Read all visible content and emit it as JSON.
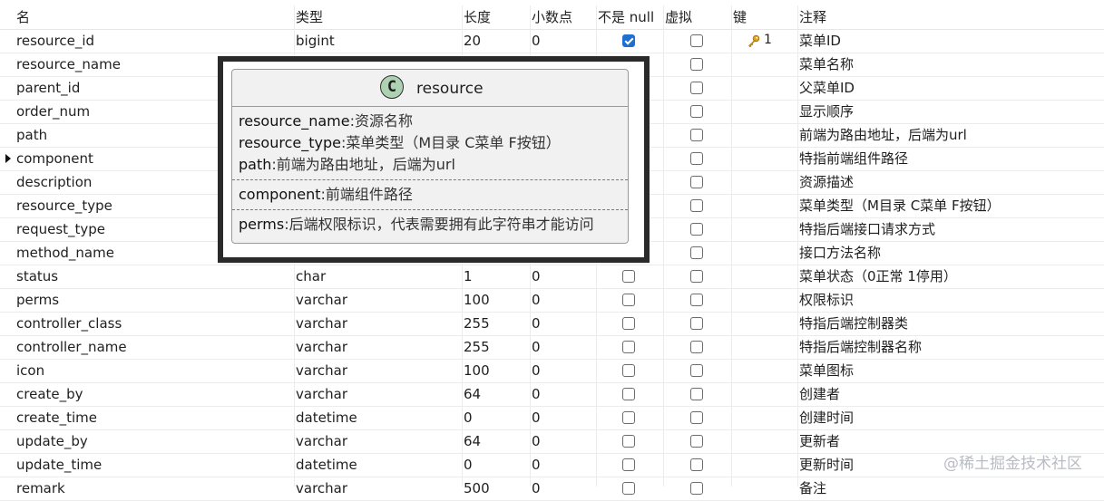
{
  "headers": [
    "名",
    "类型",
    "长度",
    "小数点",
    "不是 null",
    "虚拟",
    "键",
    "注释"
  ],
  "rows": [
    {
      "name": "resource_id",
      "type": "bigint",
      "length": "20",
      "decimals": "0",
      "not_null": true,
      "virtual": false,
      "key": "1",
      "comment": "菜单ID"
    },
    {
      "name": "resource_name",
      "type": "",
      "length": "",
      "decimals": "",
      "not_null": false,
      "virtual": false,
      "key": "",
      "comment": "菜单名称"
    },
    {
      "name": "parent_id",
      "type": "",
      "length": "",
      "decimals": "",
      "not_null": false,
      "virtual": false,
      "key": "",
      "comment": "父菜单ID"
    },
    {
      "name": "order_num",
      "type": "",
      "length": "",
      "decimals": "",
      "not_null": false,
      "virtual": false,
      "key": "",
      "comment": "显示顺序"
    },
    {
      "name": "path",
      "type": "",
      "length": "",
      "decimals": "",
      "not_null": false,
      "virtual": false,
      "key": "",
      "comment": "前端为路由地址，后端为url"
    },
    {
      "name": "component",
      "type": "",
      "length": "",
      "decimals": "",
      "not_null": false,
      "virtual": false,
      "key": "",
      "comment": "特指前端组件路径",
      "current": true
    },
    {
      "name": "description",
      "type": "",
      "length": "",
      "decimals": "",
      "not_null": false,
      "virtual": false,
      "key": "",
      "comment": "资源描述"
    },
    {
      "name": "resource_type",
      "type": "",
      "length": "",
      "decimals": "",
      "not_null": false,
      "virtual": false,
      "key": "",
      "comment": "菜单类型（M目录 C菜单 F按钮）"
    },
    {
      "name": "request_type",
      "type": "",
      "length": "",
      "decimals": "",
      "not_null": false,
      "virtual": false,
      "key": "",
      "comment": "特指后端接口请求方式"
    },
    {
      "name": "method_name",
      "type": "",
      "length": "",
      "decimals": "",
      "not_null": false,
      "virtual": false,
      "key": "",
      "comment": "接口方法名称"
    },
    {
      "name": "status",
      "type": "char",
      "length": "1",
      "decimals": "0",
      "not_null": false,
      "virtual": false,
      "key": "",
      "comment": "菜单状态（0正常 1停用）"
    },
    {
      "name": "perms",
      "type": "varchar",
      "length": "100",
      "decimals": "0",
      "not_null": false,
      "virtual": false,
      "key": "",
      "comment": "权限标识"
    },
    {
      "name": "controller_class",
      "type": "varchar",
      "length": "255",
      "decimals": "0",
      "not_null": false,
      "virtual": false,
      "key": "",
      "comment": "特指后端控制器类"
    },
    {
      "name": "controller_name",
      "type": "varchar",
      "length": "255",
      "decimals": "0",
      "not_null": false,
      "virtual": false,
      "key": "",
      "comment": "特指后端控制器名称"
    },
    {
      "name": "icon",
      "type": "varchar",
      "length": "100",
      "decimals": "0",
      "not_null": false,
      "virtual": false,
      "key": "",
      "comment": "菜单图标"
    },
    {
      "name": "create_by",
      "type": "varchar",
      "length": "64",
      "decimals": "0",
      "not_null": false,
      "virtual": false,
      "key": "",
      "comment": "创建者"
    },
    {
      "name": "create_time",
      "type": "datetime",
      "length": "0",
      "decimals": "0",
      "not_null": false,
      "virtual": false,
      "key": "",
      "comment": "创建时间"
    },
    {
      "name": "update_by",
      "type": "varchar",
      "length": "64",
      "decimals": "0",
      "not_null": false,
      "virtual": false,
      "key": "",
      "comment": "更新者"
    },
    {
      "name": "update_time",
      "type": "datetime",
      "length": "0",
      "decimals": "0",
      "not_null": false,
      "virtual": false,
      "key": "",
      "comment": "更新时间"
    },
    {
      "name": "remark",
      "type": "varchar",
      "length": "500",
      "decimals": "0",
      "not_null": false,
      "virtual": false,
      "key": "",
      "comment": "备注"
    }
  ],
  "popup": {
    "circle_letter": "C",
    "class_name": "resource",
    "sections": [
      [
        {
          "name": "resource_name",
          "desc": ":资源名称"
        },
        {
          "name": "resource_type",
          "desc": ":菜单类型（M目录 C菜单 F按钮）"
        },
        {
          "name": "path",
          "desc": ":前端为路由地址，后端为url"
        }
      ],
      [
        {
          "name": "component",
          "desc": ":前端组件路径"
        }
      ],
      [
        {
          "name": "perms",
          "desc": ":后端权限标识，代表需要拥有此字符串才能访问"
        }
      ]
    ]
  },
  "watermark": "@稀土掘金技术社区",
  "colors": {
    "checkbox_checked": "#1f6fd1",
    "key_icon": "#e2a31b",
    "uml_circle": "#add1b2",
    "popup_border": "#2a2a2a"
  }
}
